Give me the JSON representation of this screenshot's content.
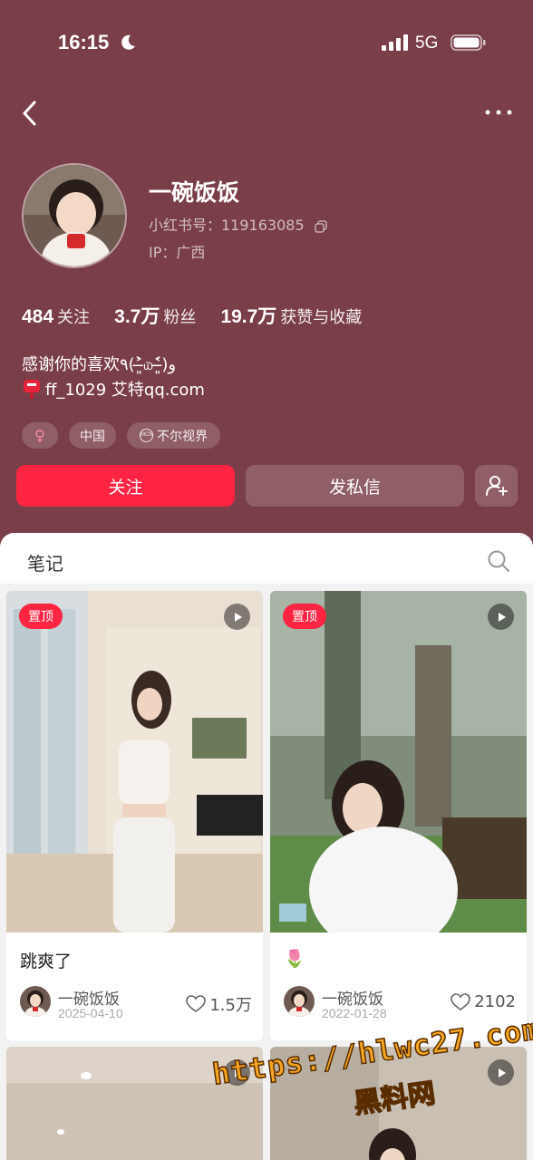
{
  "status_bar": {
    "time": "16:15",
    "network": "5G"
  },
  "profile": {
    "name": "一碗饭饭",
    "xhs_id": "小红书号：119163085",
    "ip": "IP：广西",
    "stats": [
      {
        "value": "484",
        "label": "关注"
      },
      {
        "value": "3.7万",
        "label": "粉丝"
      },
      {
        "value": "19.7万",
        "label": "获赞与收藏"
      }
    ],
    "bio_line1": "感谢你的喜欢٩(˃̶͈̀௰˂̶͈́)و",
    "bio_line2": "ff_1029 艾特qq.com",
    "tags": {
      "gender_symbol": "♀",
      "region": "中国",
      "mcn": "不尔视界",
      "mcn_icon_text": "MCN"
    },
    "follow_label": "关注",
    "message_label": "发私信"
  },
  "notes": {
    "tab_label": "笔记",
    "cards": [
      {
        "pinned": "置顶",
        "title": "跳爽了",
        "author": "一碗饭饭",
        "date": "2025-04-10",
        "likes": "1.5万"
      },
      {
        "pinned": "置顶",
        "title": "🌷",
        "author": "一碗饭饭",
        "date": "2022-01-28",
        "likes": "2102"
      }
    ]
  },
  "watermark": {
    "url": "https://hlwc27.com",
    "name": "黑料网"
  },
  "colors": {
    "profile_bg": "#7a3e48",
    "accent": "#ff2442",
    "watermark": "#f5a623"
  }
}
